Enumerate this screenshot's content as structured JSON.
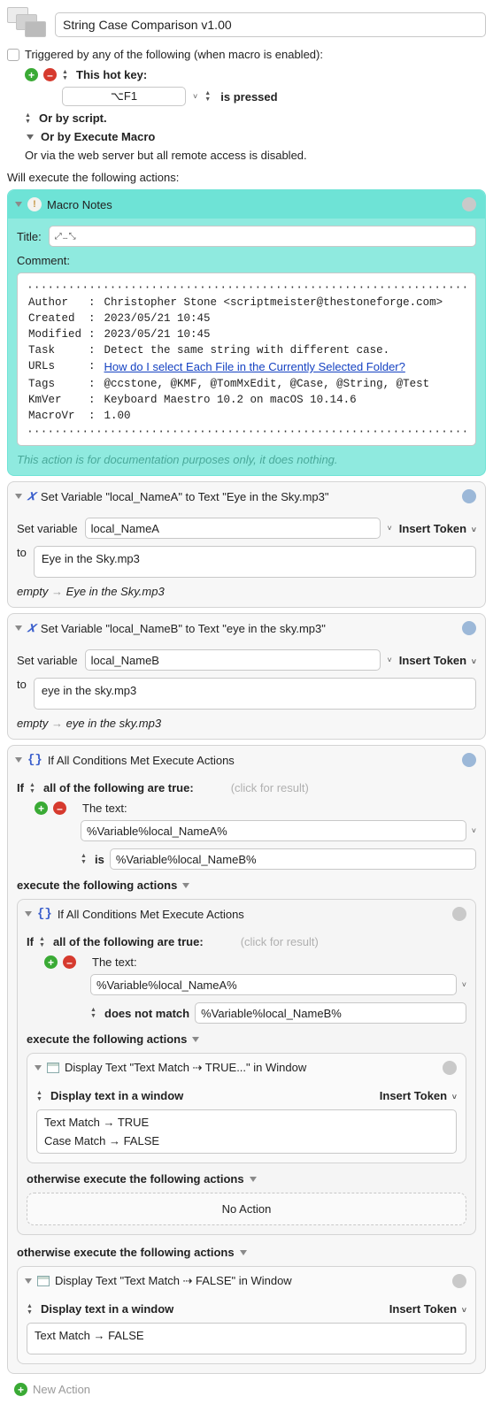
{
  "macro": {
    "title": "String Case Comparison v1.00",
    "triggered_by_label": "Triggered by any of the following (when macro is enabled):",
    "hotkey_label": "This hot key:",
    "hotkey_value": "⌥F1",
    "is_pressed": "is pressed",
    "or_script": "Or by script.",
    "or_execute_macro": "Or by Execute Macro",
    "or_web": "Or via the web server but all remote access is disabled.",
    "will_execute": "Will execute the following actions:"
  },
  "notes": {
    "header": "Macro Notes",
    "title_label": "Title:",
    "title_expand": "⤢ ... ⤡",
    "comment_label": "Comment:",
    "fields": {
      "author_key": "Author",
      "author_val": "Christopher Stone <scriptmeister@thestoneforge.com>",
      "created_key": "Created",
      "created_val": "2023/05/21 10:45",
      "modified_key": "Modified",
      "modified_val": "2023/05/21 10:45",
      "task_key": "Task",
      "task_val": "Detect the same string with different case.",
      "urls_key": "URLs",
      "urls_val": "How do I select Each File in the Currently Selected Folder?",
      "tags_key": "Tags",
      "tags_val": "@ccstone, @KMF, @TomMxEdit, @Case, @String, @Test",
      "kmver_key": "KmVer",
      "kmver_val": "Keyboard Maestro 10.2 on macOS 10.14.6",
      "macrovr_key": "MacroVr",
      "macrovr_val": "1.00"
    },
    "footer_note": "This action is for documentation purposes only, it does nothing."
  },
  "setA": {
    "header": "Set Variable \"local_NameA\" to Text \"Eye in the Sky.mp3\"",
    "set_variable_label": "Set variable",
    "var_name": "local_NameA",
    "insert_token": "Insert Token",
    "to_label": "to",
    "value": "Eye in the Sky.mp3",
    "trail_empty": "empty",
    "trail_value": "Eye in the Sky.mp3"
  },
  "setB": {
    "header": "Set Variable \"local_NameB\" to Text \"eye in the sky.mp3\"",
    "set_variable_label": "Set variable",
    "var_name": "local_NameB",
    "insert_token": "Insert Token",
    "to_label": "to",
    "value": "eye in the sky.mp3",
    "trail_empty": "empty",
    "trail_value": "eye in the sky.mp3"
  },
  "ifOuter": {
    "header": "If All Conditions Met Execute Actions",
    "if_label": "If",
    "all_true": "all of the following are true:",
    "click_hint": "(click for result)",
    "the_text": "The text:",
    "text_value": "%Variable%local_NameA%",
    "is_label": "is",
    "is_value": "%Variable%local_NameB%",
    "execute_following": "execute the following actions",
    "otherwise": "otherwise execute the following actions"
  },
  "ifInner": {
    "header": "If All Conditions Met Execute Actions",
    "if_label": "If",
    "all_true": "all of the following are true:",
    "click_hint": "(click for result)",
    "the_text": "The text:",
    "text_value": "%Variable%local_NameA%",
    "not_match_label": "does not match",
    "not_match_value": "%Variable%local_NameB%",
    "execute_following": "execute the following actions",
    "otherwise": "otherwise execute the following actions",
    "no_action": "No Action"
  },
  "displayTrue": {
    "header": "Display Text \"Text Match ⇢ TRUE...\" in Window",
    "mode_label": "Display text in a window",
    "insert_token": "Insert Token",
    "line1": "Text Match → TRUE",
    "line2": "Case Match → FALSE"
  },
  "displayFalse": {
    "header": "Display Text \"Text Match ⇢ FALSE\" in Window",
    "mode_label": "Display text in a window",
    "insert_token": "Insert Token",
    "line1": "Text Match → FALSE"
  },
  "new_action": "New Action"
}
